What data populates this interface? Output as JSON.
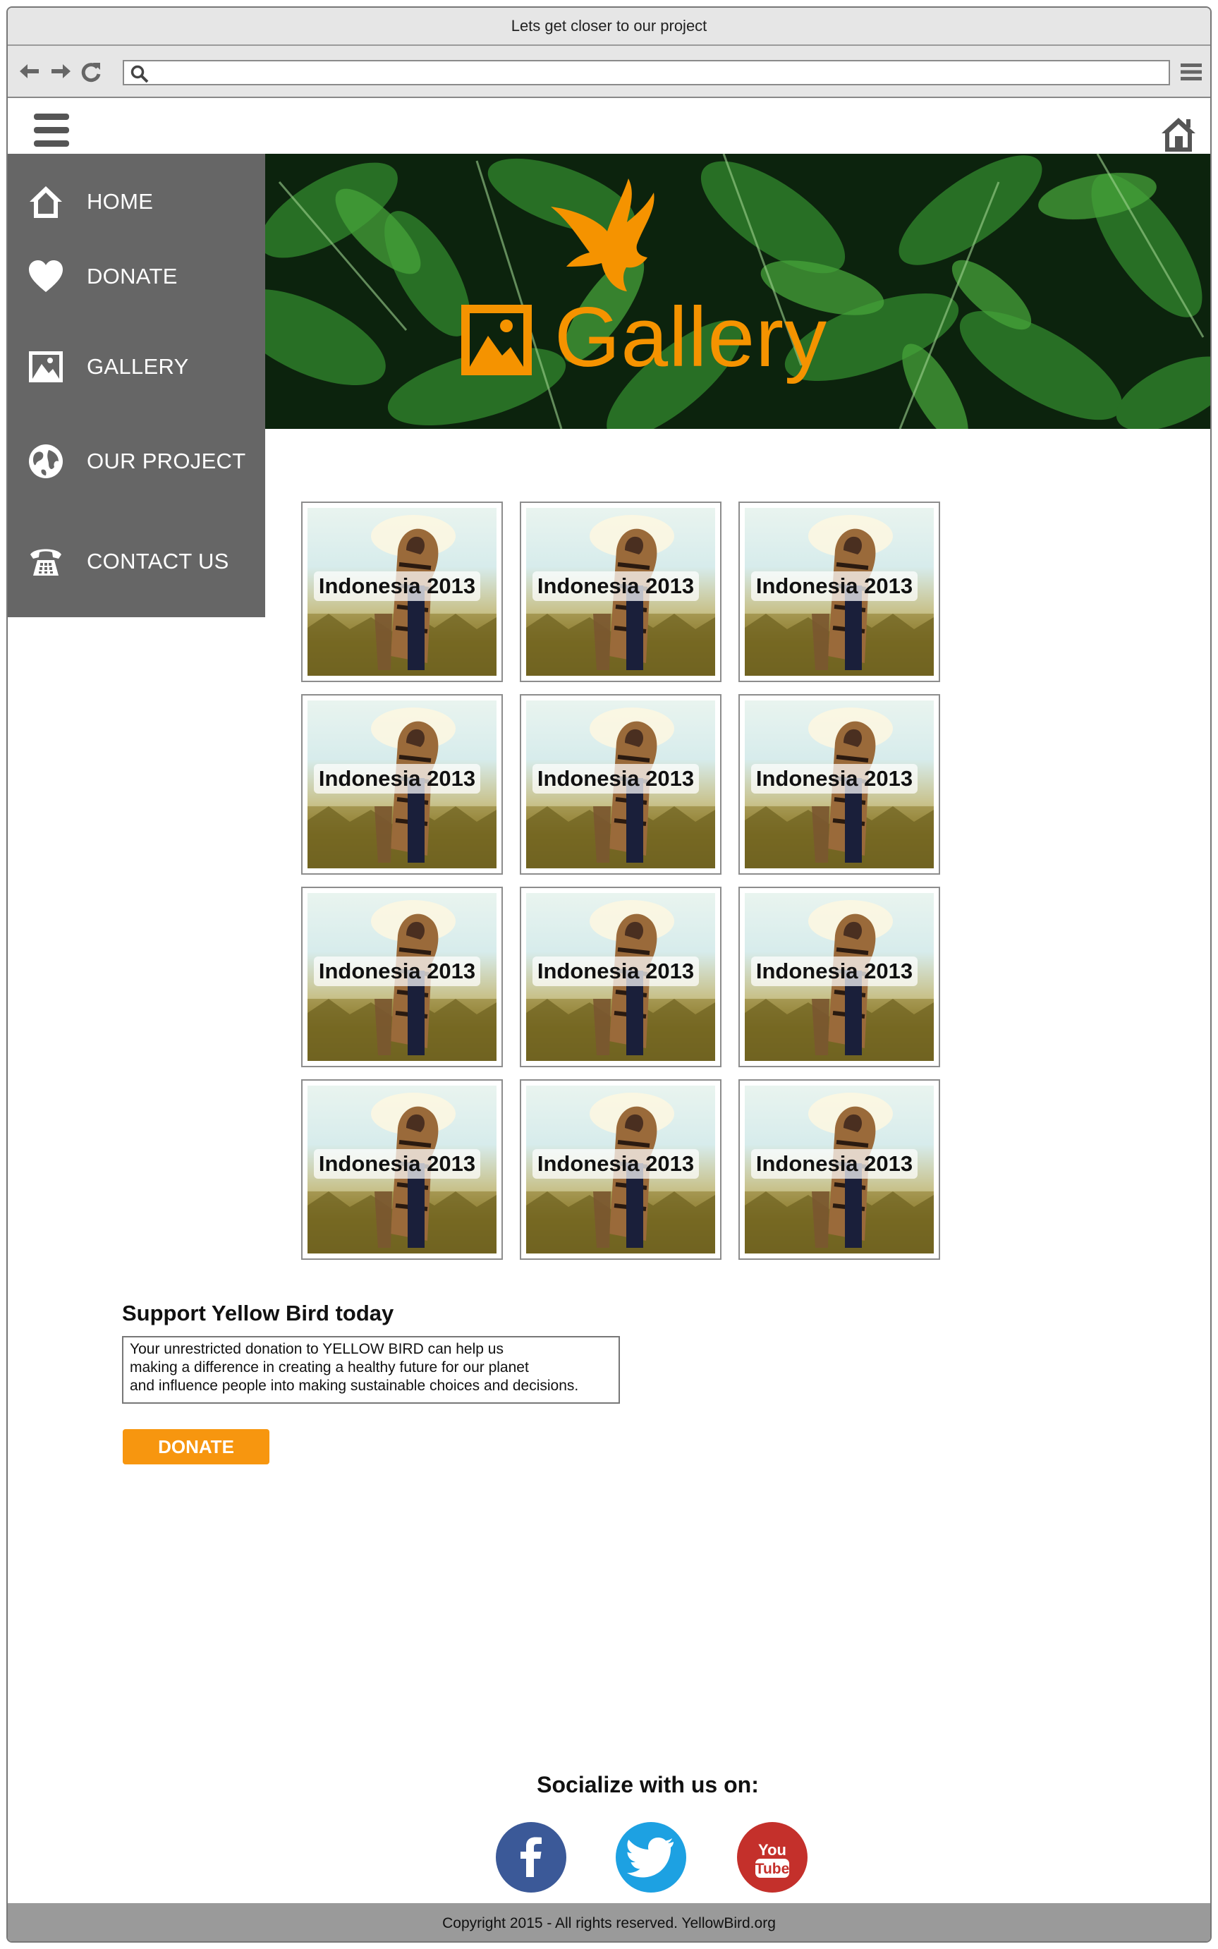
{
  "browser": {
    "window_title": "Lets get closer to our project",
    "url_value": "",
    "url_placeholder": ""
  },
  "sidebar": {
    "items": [
      {
        "label": "HOME",
        "icon": "home-icon"
      },
      {
        "label": "DONATE",
        "icon": "heart-icon"
      },
      {
        "label": "GALLERY",
        "icon": "image-icon"
      },
      {
        "label": "OUR PROJECT",
        "icon": "globe-icon"
      },
      {
        "label": "CONTACT US",
        "icon": "phone-icon"
      }
    ]
  },
  "banner": {
    "title": "Gallery",
    "logo": "bird-icon",
    "accent_color": "#f59300"
  },
  "gallery": {
    "items": [
      {
        "caption": "Indonesia 2013"
      },
      {
        "caption": "Indonesia 2013"
      },
      {
        "caption": "Indonesia 2013"
      },
      {
        "caption": "Indonesia 2013"
      },
      {
        "caption": "Indonesia 2013"
      },
      {
        "caption": "Indonesia 2013"
      },
      {
        "caption": "Indonesia 2013"
      },
      {
        "caption": "Indonesia 2013"
      },
      {
        "caption": "Indonesia 2013"
      },
      {
        "caption": "Indonesia 2013"
      },
      {
        "caption": "Indonesia 2013"
      },
      {
        "caption": "Indonesia 2013"
      }
    ]
  },
  "support": {
    "title": "Support Yellow Bird today",
    "text": "Your unrestricted donation to YELLOW BIRD can help us\nmaking a difference in creating a healthy future for our planet\nand influence people into making sustainable choices and decisions.",
    "button_label": "DONATE",
    "button_color": "#f7960f"
  },
  "social": {
    "title": "Socialize with us on:",
    "links": [
      {
        "name": "facebook",
        "icon": "facebook-icon",
        "color": "#3b5998"
      },
      {
        "name": "twitter",
        "icon": "twitter-icon",
        "color": "#1da1e2"
      },
      {
        "name": "youtube",
        "icon": "youtube-icon",
        "color": "#c4302b"
      }
    ]
  },
  "footer": {
    "text": "Copyright 2015  - All rights reserved. YellowBird.org"
  }
}
